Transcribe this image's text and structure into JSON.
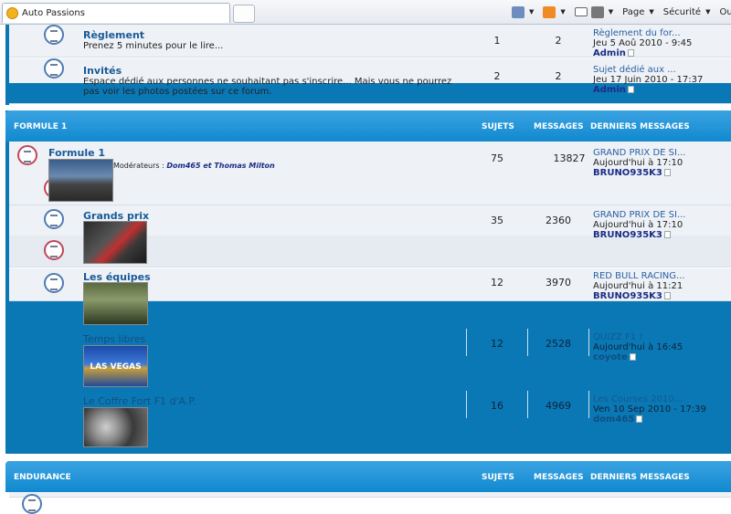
{
  "browser": {
    "tab_title": "Auto Passions",
    "menu": {
      "page": "Page",
      "security": "Sécurité",
      "tools": "Out"
    }
  },
  "colors": {
    "category_bar": "#1189cf",
    "forum_link": "#1a5a98",
    "row_bg": "#eef2f6"
  },
  "forums_top": [
    {
      "name": "Règlement",
      "desc": "Prenez 5 minutes pour le lire...",
      "topics": "1",
      "posts": "2",
      "last_title": "Règlement du for...",
      "last_date": "Jeu 5 Aoû 2010 - 9:45",
      "last_user": "Admin"
    },
    {
      "name": "Invités",
      "desc": "Espace dédié aux personnes ne souhaitant pas s'inscrire... Mais vous ne pourrez pas voir les photos postées sur ce forum.",
      "topics": "2",
      "posts": "2",
      "last_title": "Sujet dédié aux ...",
      "last_date": "Jeu 17 Juin 2010 - 17:37",
      "last_user": "Admin"
    }
  ],
  "cat_formule": {
    "title": "FORMULE 1",
    "col_topics": "SUJETS",
    "col_posts": "MESSAGES",
    "col_last": "DERNIERS MESSAGES"
  },
  "formule": {
    "name": "Formule 1",
    "mods_label": "Modérateurs :",
    "mods": "Dom465 et Thomas Milton",
    "topics": "75",
    "posts": "13827",
    "last_title": "GRAND PRIX DE SI...",
    "last_date": "Aujourd'hui à 17:10",
    "last_user": "BRUNO935K3"
  },
  "subforums": [
    {
      "name": "Grands prix",
      "topics": "35",
      "posts": "2360",
      "last_title": "GRAND PRIX DE SI...",
      "last_date": "Aujourd'hui à 17:10",
      "last_user": "BRUNO935K3"
    },
    {
      "name": "Les équipes",
      "topics": "12",
      "posts": "3970",
      "last_title": "RED BULL RACING...",
      "last_date": "Aujourd'hui à 11:21",
      "last_user": "BRUNO935K3"
    },
    {
      "name": "Temps libres",
      "topics": "12",
      "posts": "2528",
      "last_title": "QUIZZ F1 !",
      "last_date": "Aujourd'hui à 16:45",
      "last_user": "coyote"
    },
    {
      "name": "Le Coffre Fort F1 d'A.P.",
      "topics": "16",
      "posts": "4969",
      "last_title": "Les Courses 2010...",
      "last_date": "Ven 10 Sep 2010 - 17:39",
      "last_user": "dom465"
    }
  ],
  "cat_endurance": {
    "title": "ENDURANCE",
    "col_topics": "SUJETS",
    "col_posts": "MESSAGES",
    "col_last": "DERNIERS MESSAGES"
  },
  "thumbs": {
    "vegas_text": "LAS VEGAS"
  }
}
